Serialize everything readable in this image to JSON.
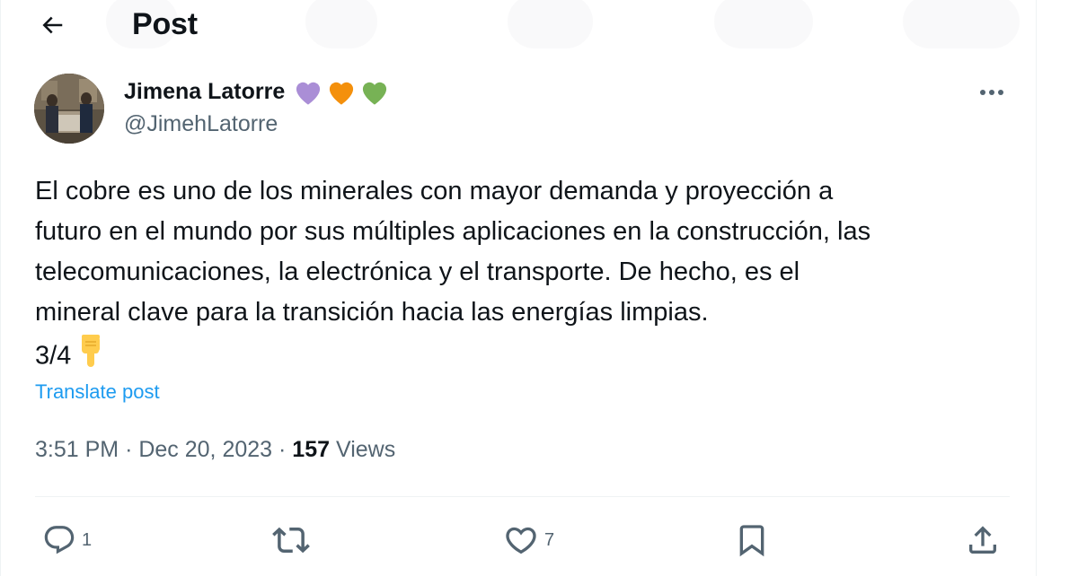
{
  "header": {
    "title": "Post"
  },
  "author": {
    "display_name": "Jimena Latorre",
    "name_emojis": [
      "purple-heart",
      "orange-heart",
      "green-heart"
    ],
    "handle": "@JimehLatorre"
  },
  "tweet": {
    "lines": [
      "El cobre es uno de los minerales con mayor demanda y proyección a",
      "futuro en el mundo por sus múltiples aplicaciones en la construcción, las",
      "telecomunicaciones, la electrónica y el transporte. De hecho, es el",
      "mineral clave para la transición hacia las energías limpias."
    ],
    "thread_marker": "3/4",
    "thread_emoji": "pointing-down-hand",
    "translate_label": "Translate post"
  },
  "meta": {
    "time": "3:51 PM",
    "separator": "·",
    "date": "Dec 20, 2023",
    "views_count": "157",
    "views_label": "Views"
  },
  "actions": {
    "reply_count": "1",
    "repost_count": "",
    "like_count": "7"
  },
  "colors": {
    "text": "#0f1419",
    "secondary": "#536471",
    "link": "#1d9bf0",
    "divider": "#eff3f4"
  },
  "icons": [
    "back-arrow-icon",
    "more-icon",
    "reply-icon",
    "repost-icon",
    "like-icon",
    "bookmark-icon",
    "share-icon"
  ]
}
